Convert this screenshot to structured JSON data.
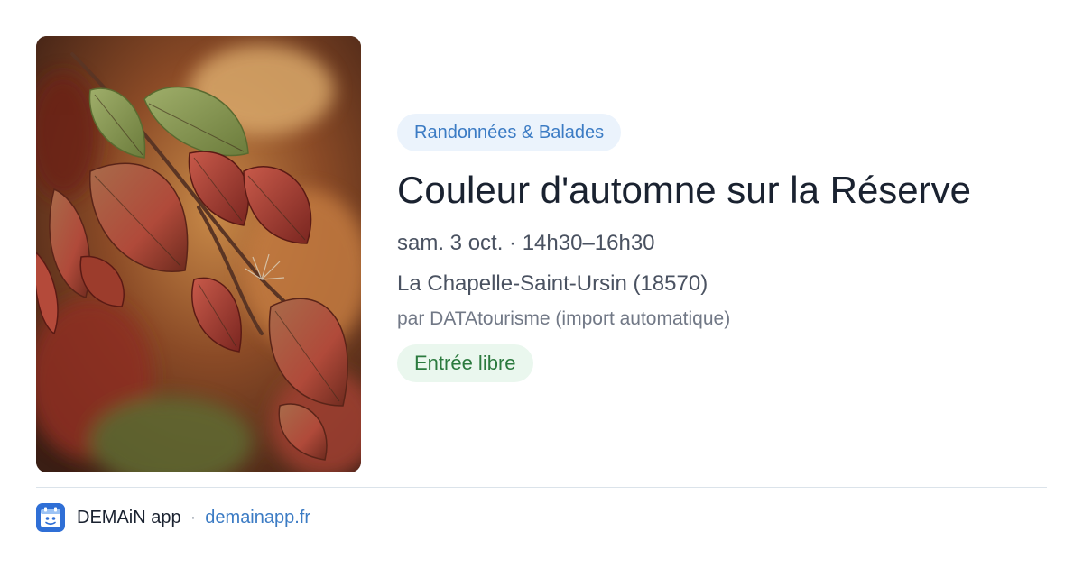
{
  "event": {
    "category": "Randonnées & Balades",
    "title": "Couleur d'automne sur la Réserve",
    "datetime": "sam. 3 oct. · 14h30–16h30",
    "location": "La Chapelle-Saint-Ursin (18570)",
    "organizer": "par DATAtourisme (import automatique)",
    "price": "Entrée libre",
    "image_subject": "autumn red dogwood leaves"
  },
  "footer": {
    "app_name": "DEMAiN app",
    "separator": "·",
    "site": "demainapp.fr",
    "icon": "demain-app-logo-icon"
  },
  "colors": {
    "category_bg": "#ebf3fc",
    "category_text": "#3b7bc4",
    "price_bg": "#eaf7ee",
    "price_text": "#2b7a3e",
    "title": "#1a2230",
    "link": "#3b7bc4",
    "app_icon_bg": "#2f6fd6"
  }
}
